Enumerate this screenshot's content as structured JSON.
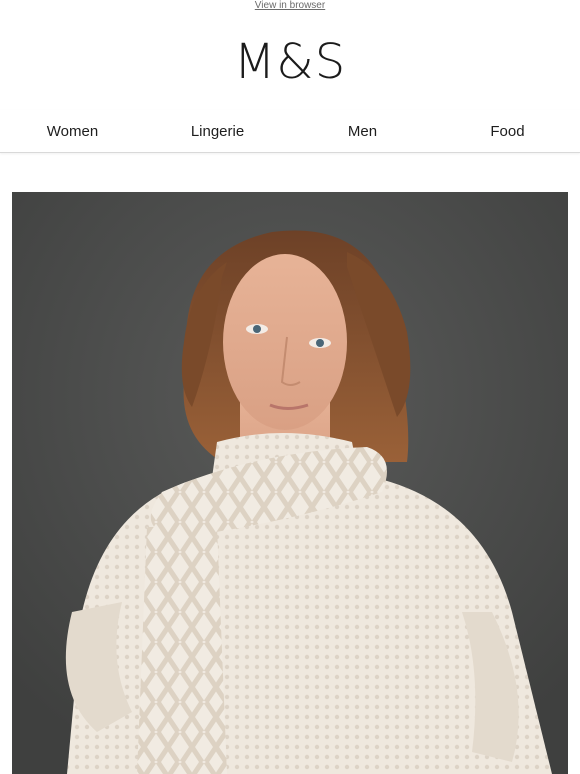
{
  "header": {
    "view_in_browser": "View in browser",
    "logo_text": "M&S"
  },
  "nav": {
    "items": [
      {
        "label": "Women"
      },
      {
        "label": "Lingerie"
      },
      {
        "label": "Men"
      },
      {
        "label": "Food"
      }
    ]
  },
  "hero": {
    "image_alt": "Model wearing a cream textured knit jumper and cable-knit scarf",
    "background_color": "#4b4c4b",
    "knit_color": "#eee6dc",
    "hair_color": "#7a4a2a"
  }
}
